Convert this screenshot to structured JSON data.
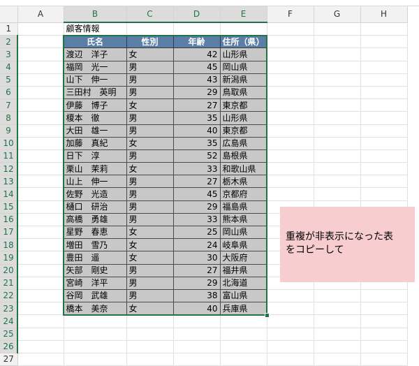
{
  "columns": [
    "A",
    "B",
    "C",
    "D",
    "E",
    "F",
    "G",
    "H"
  ],
  "rows": [
    "1",
    "2",
    "3",
    "4",
    "5",
    "6",
    "7",
    "8",
    "9",
    "10",
    "11",
    "12",
    "13",
    "14",
    "15",
    "16",
    "17",
    "18",
    "19",
    "20",
    "21",
    "22",
    "23",
    "24",
    "25",
    "26",
    "27"
  ],
  "title": "顧客情報",
  "headers": {
    "name": "氏名",
    "gender": "性別",
    "age": "年齢",
    "address": "住所（県）"
  },
  "records": [
    {
      "name": "渡辺　洋子",
      "gender": "女",
      "age": "42",
      "address": "山形県"
    },
    {
      "name": "福岡　光一",
      "gender": "男",
      "age": "45",
      "address": "岡山県"
    },
    {
      "name": "山下　伸一",
      "gender": "男",
      "age": "43",
      "address": "新潟県"
    },
    {
      "name": "三田村　英明",
      "gender": "男",
      "age": "29",
      "address": "鳥取県"
    },
    {
      "name": "伊藤　博子",
      "gender": "女",
      "age": "27",
      "address": "東京都"
    },
    {
      "name": "榎本　徹",
      "gender": "男",
      "age": "35",
      "address": "山形県"
    },
    {
      "name": "大田　雄一",
      "gender": "男",
      "age": "40",
      "address": "東京都"
    },
    {
      "name": "加藤　真紀",
      "gender": "女",
      "age": "35",
      "address": "広島県"
    },
    {
      "name": "日下　淳",
      "gender": "男",
      "age": "52",
      "address": "島根県"
    },
    {
      "name": "栗山　茉莉",
      "gender": "女",
      "age": "33",
      "address": "和歌山県"
    },
    {
      "name": "山上　伸一",
      "gender": "男",
      "age": "27",
      "address": "栃木県"
    },
    {
      "name": "佐野　光造",
      "gender": "男",
      "age": "45",
      "address": "京都府"
    },
    {
      "name": "樋口　研治",
      "gender": "男",
      "age": "29",
      "address": "福島県"
    },
    {
      "name": "高橋　勇雄",
      "gender": "男",
      "age": "33",
      "address": "熊本県"
    },
    {
      "name": "星野　春恵",
      "gender": "女",
      "age": "25",
      "address": "岡山県"
    },
    {
      "name": "増田　雪乃",
      "gender": "女",
      "age": "24",
      "address": "岐阜県"
    },
    {
      "name": "豊田　遥",
      "gender": "女",
      "age": "30",
      "address": "大阪府"
    },
    {
      "name": "矢部　剛史",
      "gender": "男",
      "age": "27",
      "address": "福井県"
    },
    {
      "name": "宮崎　洋平",
      "gender": "男",
      "age": "29",
      "address": "北海道"
    },
    {
      "name": "谷岡　武雄",
      "gender": "男",
      "age": "38",
      "address": "富山県"
    },
    {
      "name": "橋本　美奈",
      "gender": "女",
      "age": "40",
      "address": "兵庫県"
    }
  ],
  "note": {
    "line1": "重複が非表示になった表",
    "line2": "をコピーして"
  },
  "colors": {
    "header_fill": "#5b7ea6",
    "data_fill": "#c8c8c8",
    "selection": "#217346",
    "note_fill": "#f7cdd0"
  }
}
